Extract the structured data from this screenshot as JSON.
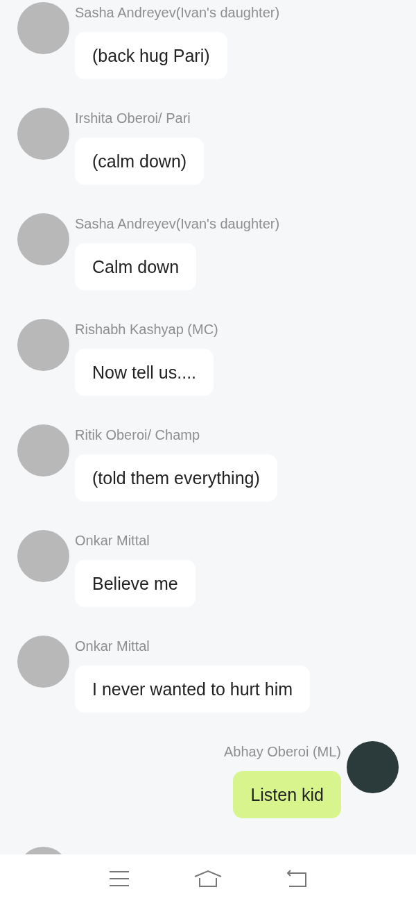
{
  "messages": [
    {
      "kind": "incoming",
      "name": "Sasha Andreyev(Ivan's daughter)",
      "text": "(back hug Pari)"
    },
    {
      "kind": "incoming",
      "name": "Irshita Oberoi/ Pari",
      "text": "(calm down)"
    },
    {
      "kind": "incoming",
      "name": "Sasha Andreyev(Ivan's daughter)",
      "text": "Calm down"
    },
    {
      "kind": "incoming",
      "name": "Rishabh Kashyap (MC)",
      "text": "Now tell us...."
    },
    {
      "kind": "incoming",
      "name": "Ritik Oberoi/ Champ",
      "text": "(told them everything)"
    },
    {
      "kind": "incoming",
      "name": "Onkar Mittal",
      "text": "Believe me"
    },
    {
      "kind": "incoming",
      "name": "Onkar Mittal",
      "text": "I never wanted to hurt him"
    },
    {
      "kind": "outgoing",
      "name": "Abhay Oberoi (ML)",
      "text": "Listen kid"
    },
    {
      "kind": "incoming"
    }
  ]
}
